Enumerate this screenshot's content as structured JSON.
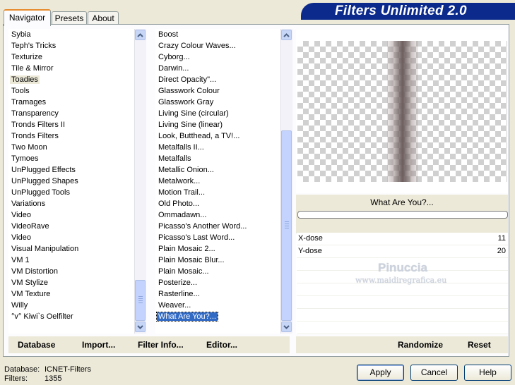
{
  "tabs": {
    "navigator": "Navigator",
    "presets": "Presets",
    "about": "About"
  },
  "banner": "Filters Unlimited 2.0",
  "categories": [
    "Sybia",
    "Teph's Tricks",
    "Texturize",
    "Tile & Mirror",
    "Toadies",
    "Tools",
    "Tramages",
    "Transparency",
    "Tronds Filters II",
    "Tronds Filters",
    "Two Moon",
    "Tymoes",
    "UnPlugged Effects",
    "UnPlugged Shapes",
    "UnPlugged Tools",
    "Variations",
    "Video",
    "VideoRave",
    "Video",
    "Visual Manipulation",
    "VM 1",
    "VM Distortion",
    "VM Stylize",
    "VM Texture",
    "Willy",
    "°v° Kiwi`s Oelfilter"
  ],
  "highlighted_category": "Toadies",
  "filters": [
    "Boost",
    "Crazy Colour Waves...",
    "Cyborg...",
    "Darwin...",
    "Direct Opacity\"...",
    "Glasswork Colour",
    "Glasswork Gray",
    "Living Sine (circular)",
    "Living Sine (linear)",
    "Look, Butthead, a TV!...",
    "Metalfalls II...",
    "Metalfalls",
    "Metallic Onion...",
    "Metalwork...",
    "Motion Trail...",
    "Old Photo...",
    "Ommadawn...",
    "Picasso's Another Word...",
    "Picasso's Last Word...",
    "Plain Mosaic 2...",
    "Plain Mosaic Blur...",
    "Plain Mosaic...",
    "Posterize...",
    "Rasterline...",
    "Weaver...",
    "What Are You?..."
  ],
  "selected_filter": "What Are You?...",
  "preview_title": "What Are You?...",
  "progress": 0,
  "params": [
    {
      "label": "X-dose",
      "value": "11"
    },
    {
      "label": "Y-dose",
      "value": "20"
    }
  ],
  "watermark": {
    "line1": "Pinuccia",
    "line2": "www.maidiregrafica.eu"
  },
  "toolbar": {
    "database": "Database",
    "import": "Import...",
    "filter_info": "Filter Info...",
    "editor": "Editor...",
    "randomize": "Randomize",
    "reset": "Reset"
  },
  "status": {
    "database_label": "Database:",
    "database_value": "ICNET-Filters",
    "filters_label": "Filters:",
    "filters_value": "1355"
  },
  "buttons": {
    "apply": "Apply",
    "cancel": "Cancel",
    "help": "Help"
  }
}
